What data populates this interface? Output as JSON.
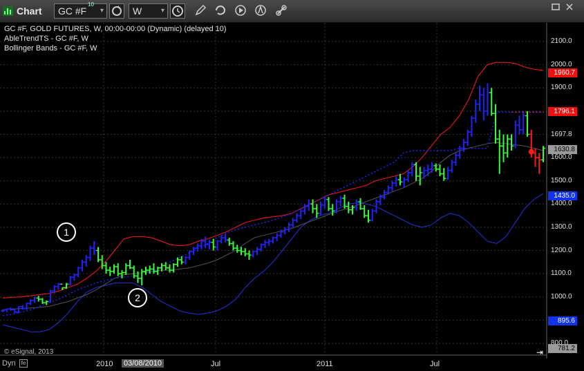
{
  "toolbar": {
    "app_title": "Chart",
    "symbol_value": "GC #F",
    "symbol_superscript": "10",
    "interval_value": "W",
    "icons": [
      "chart-app-icon",
      "refresh-icon",
      "clock-icon",
      "pencil-icon",
      "cycle-icon",
      "play-icon",
      "alert-icon",
      "link-icon",
      "maximize-icon",
      "close-icon"
    ]
  },
  "header": {
    "line1": "GC #F, GOLD FUTURES, W, 00:00-00:00 (Dynamic) (delayed 10)",
    "line2": "AbleTrendTS - GC #F, W",
    "line3": "Bollinger Bands - GC #F, W"
  },
  "copyright": "© eSignal, 2013",
  "markers": {
    "m1": "1",
    "m2": "2"
  },
  "price_axis": {
    "ticks": [
      "2100.0",
      "2000.0",
      "1900.0",
      "1800.0",
      "1697.8",
      "1600.0",
      "1500.0",
      "1400.0",
      "1300.0",
      "1200.0",
      "1100.0",
      "1000.0",
      "900.0",
      "800.0"
    ],
    "tags": {
      "upper_band": "1960.7",
      "stop_red": "1796.1",
      "last": "1630.8",
      "lower_band": "1435.0",
      "low_blue": "895.6",
      "bottom": "781.2"
    }
  },
  "time_axis": {
    "labels": [
      "2010",
      "03/08/2010",
      "Jul",
      "2011",
      "Jul"
    ],
    "selected": "03/08/2010"
  },
  "status_bar": {
    "dyn": "Dyn",
    "f": "fe"
  },
  "colors": {
    "background": "#000000",
    "grid": "#333333",
    "bull": "#33ff33",
    "bear": "#2222ff",
    "red_band": "#ff1a1a",
    "blue_band": "#2233dd",
    "stop_red": "#ff1a1a",
    "tag_red": "#ee1111",
    "tag_blue": "#1133ee",
    "tag_gray": "#999999"
  },
  "chart_data": {
    "type": "ohlc",
    "symbol": "GC #F",
    "interval": "W",
    "ylim": [
      780,
      2150
    ],
    "y_axis_ticks": [
      800,
      900,
      1000,
      1100,
      1200,
      1300,
      1400,
      1500,
      1600,
      1700,
      1800,
      1900,
      2000,
      2100
    ],
    "x_axis_labels": [
      "2010",
      "03/08/2010",
      "Jul",
      "2011",
      "Jul"
    ],
    "bars": [
      [
        940,
        945,
        935,
        940,
        0
      ],
      [
        945,
        950,
        935,
        948,
        0
      ],
      [
        948,
        955,
        940,
        945,
        0
      ],
      [
        945,
        950,
        930,
        935,
        0
      ],
      [
        935,
        960,
        930,
        958,
        0
      ],
      [
        958,
        965,
        945,
        950,
        0
      ],
      [
        950,
        975,
        945,
        972,
        0
      ],
      [
        972,
        990,
        965,
        985,
        0
      ],
      [
        985,
        1000,
        975,
        995,
        0
      ],
      [
        995,
        1005,
        980,
        990,
        1
      ],
      [
        990,
        995,
        970,
        975,
        1
      ],
      [
        975,
        985,
        965,
        980,
        1
      ],
      [
        980,
        1030,
        975,
        1025,
        0
      ],
      [
        1025,
        1050,
        1015,
        1045,
        0
      ],
      [
        1045,
        1060,
        1030,
        1055,
        0
      ],
      [
        1055,
        1040,
        1030,
        1040,
        1
      ],
      [
        1040,
        1060,
        1035,
        1055,
        1
      ],
      [
        1055,
        1090,
        1050,
        1085,
        0
      ],
      [
        1085,
        1100,
        1070,
        1095,
        0
      ],
      [
        1095,
        1130,
        1085,
        1125,
        0
      ],
      [
        1125,
        1160,
        1110,
        1150,
        0
      ],
      [
        1150,
        1180,
        1130,
        1170,
        0
      ],
      [
        1170,
        1220,
        1155,
        1210,
        0
      ],
      [
        1210,
        1240,
        1180,
        1200,
        0
      ],
      [
        1200,
        1215,
        1150,
        1160,
        1
      ],
      [
        1160,
        1180,
        1120,
        1135,
        1
      ],
      [
        1135,
        1150,
        1100,
        1115,
        1
      ],
      [
        1115,
        1130,
        1090,
        1110,
        1
      ],
      [
        1110,
        1140,
        1100,
        1130,
        1
      ],
      [
        1130,
        1145,
        1090,
        1100,
        1
      ],
      [
        1100,
        1115,
        1080,
        1105,
        1
      ],
      [
        1105,
        1145,
        1095,
        1135,
        1
      ],
      [
        1135,
        1160,
        1120,
        1125,
        1
      ],
      [
        1125,
        1135,
        1080,
        1090,
        1
      ],
      [
        1090,
        1110,
        1060,
        1080,
        1
      ],
      [
        1080,
        1120,
        1050,
        1110,
        1
      ],
      [
        1110,
        1130,
        1095,
        1115,
        1
      ],
      [
        1115,
        1135,
        1100,
        1120,
        1
      ],
      [
        1120,
        1145,
        1100,
        1110,
        1
      ],
      [
        1110,
        1130,
        1095,
        1125,
        1
      ],
      [
        1125,
        1145,
        1110,
        1135,
        1
      ],
      [
        1135,
        1150,
        1115,
        1125,
        1
      ],
      [
        1125,
        1140,
        1105,
        1115,
        1
      ],
      [
        1115,
        1145,
        1105,
        1140,
        1
      ],
      [
        1140,
        1170,
        1130,
        1160,
        1
      ],
      [
        1160,
        1175,
        1140,
        1150,
        1
      ],
      [
        1150,
        1175,
        1140,
        1170,
        0
      ],
      [
        1170,
        1200,
        1160,
        1195,
        0
      ],
      [
        1195,
        1215,
        1180,
        1210,
        0
      ],
      [
        1210,
        1230,
        1195,
        1220,
        0
      ],
      [
        1220,
        1250,
        1205,
        1240,
        0
      ],
      [
        1240,
        1260,
        1210,
        1225,
        0
      ],
      [
        1225,
        1245,
        1205,
        1235,
        0
      ],
      [
        1235,
        1250,
        1200,
        1215,
        1
      ],
      [
        1215,
        1245,
        1200,
        1240,
        0
      ],
      [
        1240,
        1265,
        1230,
        1255,
        0
      ],
      [
        1255,
        1270,
        1235,
        1245,
        0
      ],
      [
        1245,
        1255,
        1220,
        1230,
        1
      ],
      [
        1230,
        1240,
        1200,
        1210,
        1
      ],
      [
        1210,
        1225,
        1190,
        1200,
        1
      ],
      [
        1200,
        1215,
        1180,
        1195,
        1
      ],
      [
        1195,
        1210,
        1175,
        1185,
        1
      ],
      [
        1185,
        1200,
        1160,
        1180,
        1
      ],
      [
        1180,
        1200,
        1170,
        1195,
        0
      ],
      [
        1195,
        1215,
        1180,
        1205,
        0
      ],
      [
        1205,
        1230,
        1195,
        1225,
        0
      ],
      [
        1225,
        1245,
        1210,
        1235,
        0
      ],
      [
        1235,
        1250,
        1220,
        1240,
        0
      ],
      [
        1240,
        1260,
        1230,
        1255,
        0
      ],
      [
        1255,
        1275,
        1240,
        1265,
        0
      ],
      [
        1265,
        1290,
        1255,
        1280,
        0
      ],
      [
        1280,
        1300,
        1270,
        1290,
        0
      ],
      [
        1290,
        1320,
        1280,
        1310,
        0
      ],
      [
        1310,
        1340,
        1300,
        1330,
        0
      ],
      [
        1330,
        1360,
        1320,
        1350,
        0
      ],
      [
        1350,
        1380,
        1335,
        1370,
        0
      ],
      [
        1370,
        1400,
        1355,
        1390,
        0
      ],
      [
        1390,
        1420,
        1370,
        1400,
        0
      ],
      [
        1400,
        1420,
        1360,
        1380,
        1
      ],
      [
        1380,
        1400,
        1340,
        1360,
        1
      ],
      [
        1360,
        1410,
        1350,
        1395,
        0
      ],
      [
        1395,
        1430,
        1380,
        1420,
        0
      ],
      [
        1420,
        1430,
        1370,
        1380,
        1
      ],
      [
        1380,
        1400,
        1350,
        1370,
        1
      ],
      [
        1370,
        1420,
        1360,
        1410,
        0
      ],
      [
        1410,
        1435,
        1390,
        1425,
        0
      ],
      [
        1425,
        1440,
        1380,
        1390,
        1
      ],
      [
        1390,
        1410,
        1360,
        1375,
        1
      ],
      [
        1375,
        1395,
        1355,
        1385,
        1
      ],
      [
        1385,
        1420,
        1370,
        1410,
        0
      ],
      [
        1410,
        1425,
        1375,
        1380,
        1
      ],
      [
        1380,
        1395,
        1340,
        1350,
        1
      ],
      [
        1350,
        1375,
        1320,
        1330,
        1
      ],
      [
        1330,
        1380,
        1325,
        1370,
        0
      ],
      [
        1370,
        1420,
        1360,
        1410,
        0
      ],
      [
        1410,
        1440,
        1395,
        1430,
        0
      ],
      [
        1430,
        1460,
        1420,
        1450,
        0
      ],
      [
        1450,
        1480,
        1440,
        1470,
        0
      ],
      [
        1470,
        1500,
        1455,
        1490,
        0
      ],
      [
        1490,
        1520,
        1475,
        1505,
        0
      ],
      [
        1505,
        1530,
        1480,
        1495,
        1
      ],
      [
        1495,
        1515,
        1470,
        1505,
        0
      ],
      [
        1505,
        1545,
        1495,
        1535,
        0
      ],
      [
        1535,
        1580,
        1520,
        1570,
        0
      ],
      [
        1570,
        1580,
        1500,
        1520,
        1
      ],
      [
        1520,
        1560,
        1480,
        1535,
        1
      ],
      [
        1535,
        1560,
        1510,
        1545,
        0
      ],
      [
        1545,
        1570,
        1520,
        1550,
        0
      ],
      [
        1550,
        1580,
        1535,
        1565,
        0
      ],
      [
        1565,
        1575,
        1540,
        1550,
        1
      ],
      [
        1550,
        1570,
        1520,
        1530,
        1
      ],
      [
        1530,
        1555,
        1500,
        1510,
        1
      ],
      [
        1510,
        1560,
        1505,
        1545,
        0
      ],
      [
        1545,
        1590,
        1535,
        1580,
        0
      ],
      [
        1580,
        1620,
        1565,
        1610,
        0
      ],
      [
        1610,
        1650,
        1595,
        1640,
        0
      ],
      [
        1640,
        1680,
        1625,
        1665,
        0
      ],
      [
        1665,
        1720,
        1650,
        1710,
        0
      ],
      [
        1710,
        1780,
        1690,
        1770,
        0
      ],
      [
        1770,
        1850,
        1750,
        1830,
        0
      ],
      [
        1830,
        1910,
        1800,
        1870,
        0
      ],
      [
        1870,
        1900,
        1760,
        1800,
        0
      ],
      [
        1800,
        1920,
        1780,
        1880,
        0
      ],
      [
        1880,
        1900,
        1780,
        1790,
        1
      ],
      [
        1790,
        1830,
        1660,
        1680,
        1
      ],
      [
        1680,
        1720,
        1530,
        1650,
        1
      ],
      [
        1650,
        1700,
        1580,
        1620,
        1
      ],
      [
        1620,
        1700,
        1600,
        1680,
        1
      ],
      [
        1680,
        1700,
        1630,
        1650,
        1
      ],
      [
        1650,
        1760,
        1640,
        1740,
        0
      ],
      [
        1740,
        1780,
        1700,
        1720,
        0
      ],
      [
        1720,
        1800,
        1700,
        1780,
        0
      ],
      [
        1780,
        1800,
        1690,
        1700,
        1
      ],
      [
        1700,
        1720,
        1600,
        1620,
        2
      ],
      [
        1620,
        1640,
        1560,
        1600,
        2
      ],
      [
        1600,
        1620,
        1530,
        1590,
        2
      ],
      [
        1590,
        1650,
        1580,
        1640,
        1
      ]
    ],
    "bar_fields": [
      "open",
      "high",
      "low",
      "close",
      "color_code(0=bear_blue,1=bull_green,2=stop_red)"
    ],
    "upper_band": [
      995,
      998,
      1000,
      1005,
      1010,
      1015,
      1025,
      1040,
      1055,
      1080,
      1110,
      1150,
      1200,
      1250,
      1260,
      1260,
      1255,
      1240,
      1225,
      1220,
      1225,
      1240,
      1250,
      1265,
      1280,
      1300,
      1320,
      1330,
      1340,
      1345,
      1350,
      1360,
      1380,
      1400,
      1420,
      1440,
      1450,
      1460,
      1470,
      1480,
      1500,
      1510,
      1520,
      1530,
      1560,
      1600,
      1650,
      1700,
      1730,
      1780,
      1850,
      1950,
      2000,
      2010,
      2010,
      2005,
      1990,
      1980,
      1975
    ],
    "lower_band": [
      880,
      870,
      860,
      850,
      850,
      860,
      890,
      930,
      980,
      1020,
      1040,
      1050,
      1060,
      1060,
      1060,
      1040,
      1010,
      980,
      960,
      940,
      930,
      925,
      930,
      940,
      960,
      990,
      1040,
      1080,
      1110,
      1150,
      1200,
      1250,
      1300,
      1330,
      1350,
      1360,
      1380,
      1400,
      1405,
      1400,
      1390,
      1370,
      1350,
      1330,
      1310,
      1300,
      1310,
      1340,
      1360,
      1350,
      1320,
      1280,
      1240,
      1230,
      1260,
      1320,
      1380,
      1420,
      1445
    ],
    "middle_band": [
      945,
      948,
      950,
      952,
      955,
      960,
      970,
      980,
      995,
      1010,
      1030,
      1055,
      1080,
      1095,
      1100,
      1105,
      1110,
      1115,
      1115,
      1120,
      1125,
      1135,
      1145,
      1160,
      1180,
      1200,
      1230,
      1255,
      1265,
      1275,
      1285,
      1295,
      1310,
      1325,
      1340,
      1355,
      1370,
      1380,
      1395,
      1410,
      1425,
      1440,
      1455,
      1470,
      1490,
      1510,
      1540,
      1580,
      1610,
      1630,
      1640,
      1650,
      1660,
      1665,
      1660,
      1655,
      1650,
      1640,
      1630
    ],
    "trend_stop": [
      920,
      925,
      935,
      945,
      960,
      975,
      990,
      1010,
      1030,
      1045,
      1060,
      1070,
      1080,
      1085,
      1090,
      1100,
      1110,
      1130,
      1150,
      1170,
      1190,
      1210,
      1230,
      1255,
      1275,
      1290,
      1300,
      1310,
      1320,
      1330,
      1345,
      1360,
      1380,
      1400,
      1420,
      1440,
      1460,
      1480,
      1500,
      1520,
      1540,
      1560,
      1580,
      1620,
      1630,
      1630,
      1630,
      1630,
      1630,
      1640,
      1640,
      1640,
      1640,
      1796,
      1796,
      1796,
      1796,
      1796,
      1796
    ]
  }
}
